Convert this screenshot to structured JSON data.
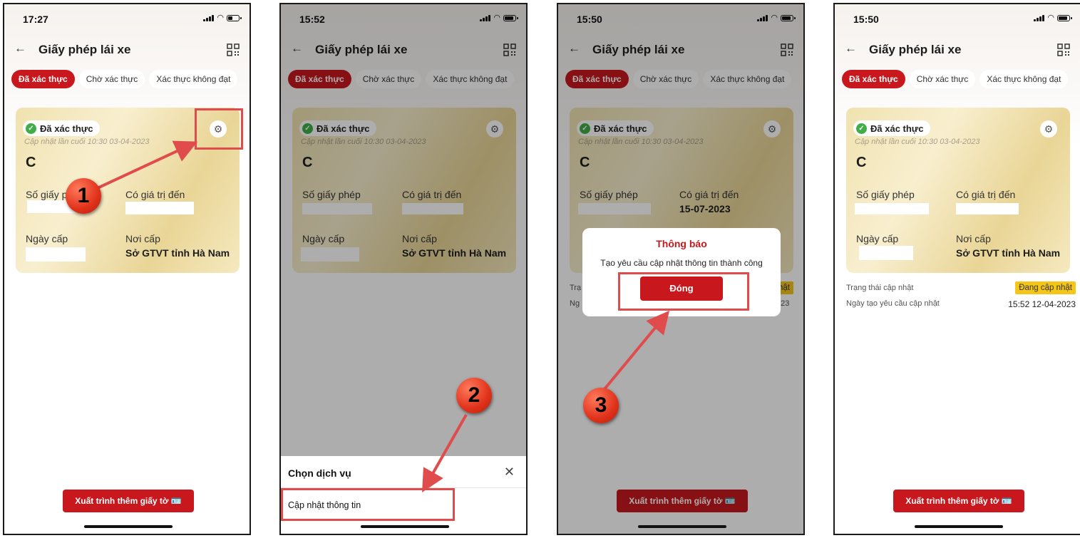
{
  "common": {
    "nav_title": "Giấy phép lái xe",
    "back_glyph": "←",
    "tabs": [
      "Đã xác thực",
      "Chờ xác thực",
      "Xác thực không đạt"
    ],
    "verified_label": "Đã xác thực",
    "verified_check_glyph": "✓",
    "gear_glyph": "⚙",
    "updated_text": "Cập nhật lần cuối 10:30 03-04-2023",
    "license_class": "C",
    "license_number_label": "Số giấy phép",
    "valid_until_label": "Có giá trị đến",
    "issue_date_label": "Ngày cấp",
    "issue_place_label": "Nơi cấp",
    "issue_place_value": "Sở GTVT tỉnh Hà Nam",
    "present_button": "Xuất trình thêm giấy tờ 🪪",
    "icons": {
      "back": "arrow-left-icon",
      "qr": "qr-code-icon",
      "gear": "gear-icon",
      "check": "check-circle-icon",
      "close": "close-icon"
    },
    "colors": {
      "brand_red": "#c8181e",
      "verified_green": "#3fae49",
      "pending_yellow": "#f5c518",
      "highlight_red": "#e04c4c"
    }
  },
  "screens": [
    {
      "time": "17:27",
      "battery_level": 0.45
    },
    {
      "time": "15:52",
      "battery_level": 0.8
    },
    {
      "time": "15:50",
      "battery_level": 0.8
    },
    {
      "time": "15:50",
      "battery_level": 0.8
    }
  ],
  "screen3": {
    "valid_until_value": "15-07-2023",
    "truncated_left": [
      "Trạ",
      "Ng"
    ],
    "truncated_right": [
      "hật",
      "023"
    ]
  },
  "screen2_sheet": {
    "title": "Chọn dịch vụ",
    "close_glyph": "✕",
    "item": "Cập nhật thông tin"
  },
  "dialog": {
    "title": "Thông báo",
    "message": "Tạo yêu cầu cập nhật thông tin thành công",
    "button": "Đóng"
  },
  "screen4": {
    "update_status_label": "Trạng thái cập nhật",
    "update_status_value": "Đang cập nhật",
    "request_date_label": "Ngày tạo yêu cầu cập nhật",
    "request_date_value": "15:52 12-04-2023"
  },
  "steps": [
    "1",
    "2",
    "3"
  ]
}
